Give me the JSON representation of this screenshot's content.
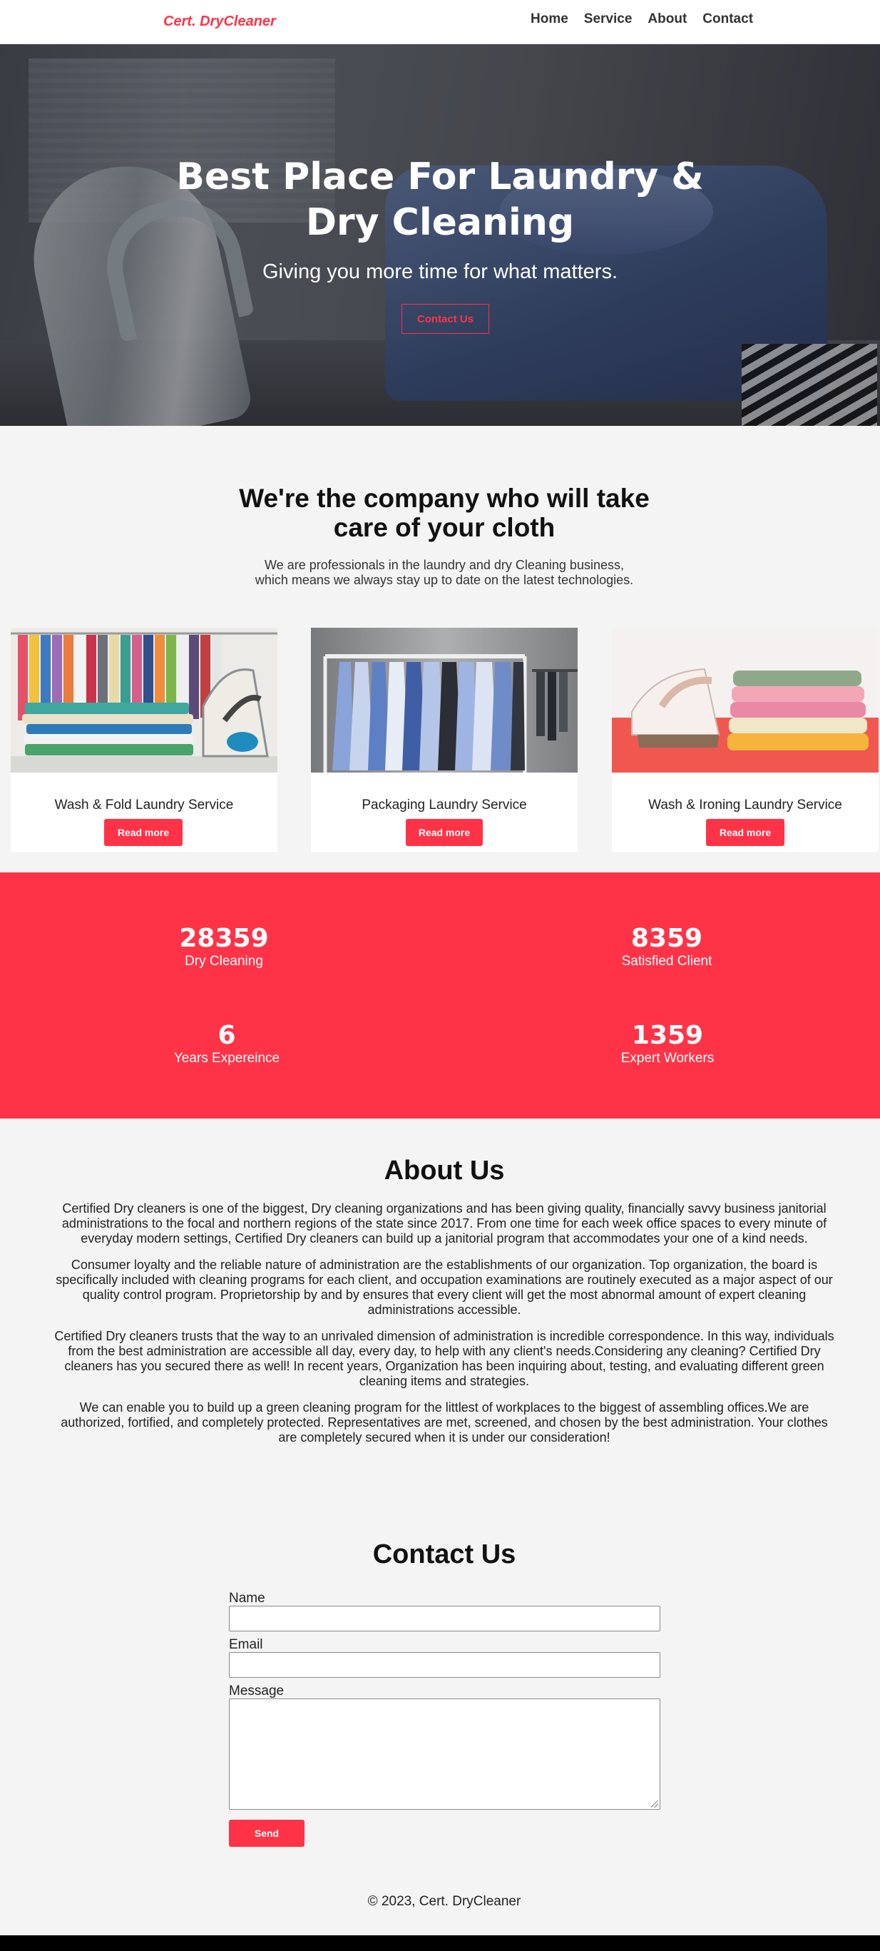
{
  "navbar": {
    "brand": "Cert. DryCleaner",
    "links": [
      "Home",
      "Service",
      "About",
      "Contact"
    ]
  },
  "hero": {
    "title_line1": "Best Place For Laundry &",
    "title_line2": "Dry Cleaning",
    "subtitle": "Giving you more time for what matters.",
    "button": "Contact Us"
  },
  "company": {
    "title_line1": "We're the company who will take",
    "title_line2": "care of your cloth",
    "desc_line1": "We are professionals in the laundry and dry Cleaning business,",
    "desc_line2": "which means we always stay up to date on the latest technologies."
  },
  "services": [
    {
      "title": "Wash & Fold Laundry Service",
      "button": "Read more"
    },
    {
      "title": "Packaging Laundry Service",
      "button": "Read more"
    },
    {
      "title": "Wash & Ironing Laundry Service",
      "button": "Read more"
    }
  ],
  "stats": [
    {
      "number": "28359",
      "label": "Dry Cleaning"
    },
    {
      "number": "8359",
      "label": "Satisfied Client"
    },
    {
      "number": "6",
      "label": "Years Expereince"
    },
    {
      "number": "1359",
      "label": "Expert Workers"
    }
  ],
  "about": {
    "title": "About Us",
    "paragraphs": [
      "Certified Dry cleaners is one of the biggest, Dry cleaning organizations and has been giving quality, financially savvy business janitorial administrations to the focal and northern regions of the state since 2017. From one time for each week office spaces to every minute of everyday modern settings, Certified Dry cleaners can build up a janitorial program that accommodates your one of a kind needs.",
      "Consumer loyalty and the reliable nature of administration are the establishments of our organization. Top organization, the board is specifically included with cleaning programs for each client, and occupation examinations are routinely executed as a major aspect of our quality control program. Proprietorship by and by ensures that every client will get the most abnormal amount of expert cleaning administrations accessible.",
      "Certified Dry cleaners trusts that the way to an unrivaled dimension of administration is incredible correspondence. In this way, individuals from the best administration are accessible all day, every day, to help with any client's needs.Considering any cleaning? Certified Dry cleaners has you secured there as well! In recent years, Organization has been inquiring about, testing, and evaluating different green cleaning items and strategies.",
      "We can enable you to build up a green cleaning program for the littlest of workplaces to the biggest of assembling offices.We are authorized, fortified, and completely protected. Representatives are met, screened, and chosen by the best administration. Your clothes are completely secured when it is under our consideration!"
    ]
  },
  "contact": {
    "title": "Contact Us",
    "name_label": "Name",
    "name_value": "",
    "email_label": "Email",
    "email_value": "",
    "message_label": "Message",
    "message_value": "",
    "send": "Send"
  },
  "footer": {
    "text": "© 2023, Cert. DryCleaner"
  },
  "colors": {
    "accent": "#ff3347",
    "background": "#f4f4f4"
  }
}
